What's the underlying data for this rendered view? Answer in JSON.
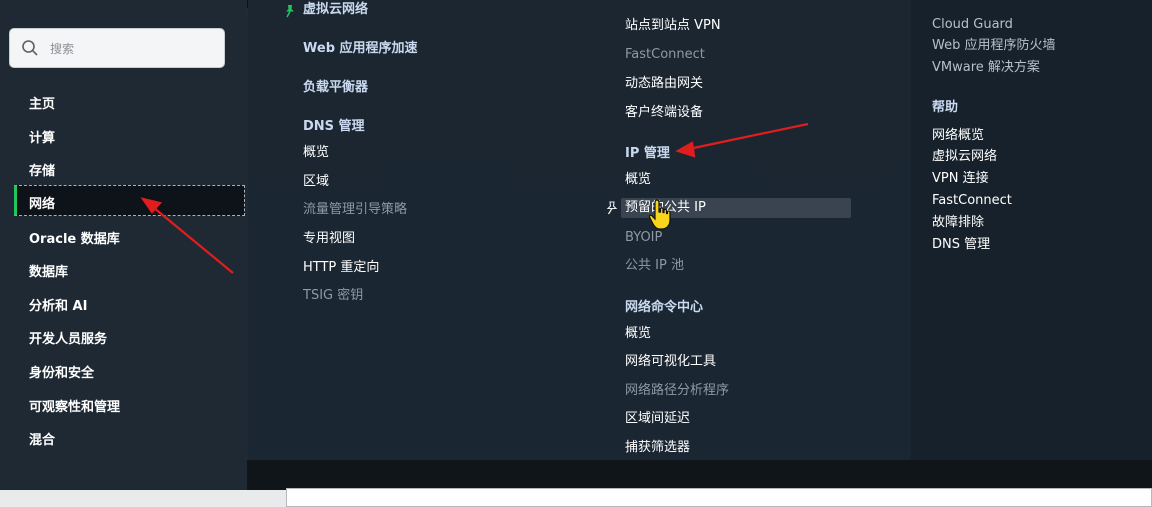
{
  "search": {
    "placeholder": "搜索"
  },
  "sidebar": {
    "items": [
      {
        "label": "主页"
      },
      {
        "label": "计算"
      },
      {
        "label": "存储"
      },
      {
        "label": "网络",
        "active": true
      },
      {
        "label": "Oracle 数据库"
      },
      {
        "label": "数据库"
      },
      {
        "label": "分析和 AI"
      },
      {
        "label": "开发人员服务"
      },
      {
        "label": "身份和安全"
      },
      {
        "label": "可观察性和管理"
      },
      {
        "label": "混合"
      }
    ]
  },
  "col1": {
    "vcn_partial": "虚拟云网络",
    "waf": "Web 应用程序加速",
    "lb": "负载平衡器",
    "dns_heading": "DNS 管理",
    "dns_items": [
      "概览",
      "区域",
      "流量管理引导策略",
      "专用视图",
      "HTTP 重定向",
      "TSIG 密钥"
    ]
  },
  "col2": {
    "vpn_items": [
      "站点到站点 VPN",
      "FastConnect",
      "动态路由网关",
      "客户终端设备"
    ],
    "ip_heading": "IP 管理",
    "ip_items": [
      "概览",
      "预留的公共 IP",
      "BYOIP",
      "公共 IP 池"
    ],
    "nc_heading": "网络命令中心",
    "nc_items": [
      "概览",
      "网络可视化工具",
      "网络路径分析程序",
      "区域间延迟",
      "捕获筛选器"
    ]
  },
  "col3": {
    "top_items": [
      "Cloud Guard",
      "Web 应用程序防火墙",
      "VMware 解决方案"
    ],
    "help_heading": "帮助",
    "help_items": [
      "网络概览",
      "虚拟云网络",
      "VPN 连接",
      "FastConnect",
      "故障排除",
      "DNS 管理"
    ]
  },
  "colors": {
    "accent_active": "#22c55e",
    "annotation_arrow": "#e11d1d"
  }
}
